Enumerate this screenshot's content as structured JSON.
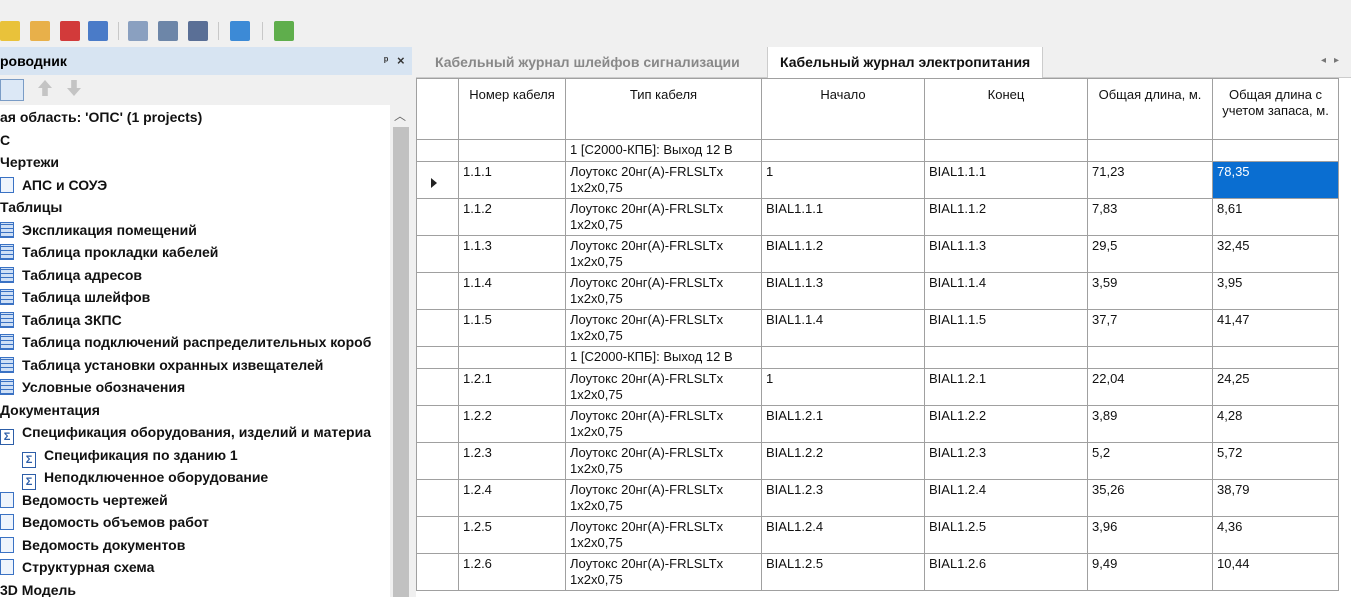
{
  "colors": {
    "accent": "#0a6ed1",
    "header_bg": "#d7e4f2"
  },
  "toolbar": {
    "icons": [
      "new-icon",
      "open-icon",
      "close-file-icon",
      "save-icon",
      "properties-icon",
      "settings-icon",
      "print-icon",
      "tree-icon",
      "add-sheet-icon"
    ]
  },
  "explorer": {
    "title": "роводник",
    "pin_glyph": "ᵖ",
    "close_glyph": "×",
    "tree": [
      {
        "label": "ая область: 'ОПС' (1 projects)",
        "icon": "none",
        "indent": 0
      },
      {
        "label": "С",
        "icon": "none",
        "indent": 0
      },
      {
        "label": "Чертежи",
        "icon": "none",
        "indent": 0
      },
      {
        "label": "АПС и СОУЭ",
        "icon": "drawing-icon",
        "indent": 1
      },
      {
        "label": "Таблицы",
        "icon": "none",
        "indent": 0
      },
      {
        "label": "Экспликация помещений",
        "icon": "table-icon",
        "indent": 1
      },
      {
        "label": "Таблица прокладки кабелей",
        "icon": "table-icon",
        "indent": 1
      },
      {
        "label": "Таблица адресов",
        "icon": "table-icon",
        "indent": 1
      },
      {
        "label": "Таблица шлейфов",
        "icon": "table-icon",
        "indent": 1
      },
      {
        "label": "Таблица ЗКПС",
        "icon": "table-icon",
        "indent": 1
      },
      {
        "label": "Таблица подключений распределительных короб",
        "icon": "table-icon",
        "indent": 1
      },
      {
        "label": "Таблица установки охранных извещателей",
        "icon": "table-icon",
        "indent": 1
      },
      {
        "label": "Условные обозначения",
        "icon": "table-icon",
        "indent": 1
      },
      {
        "label": "Документация",
        "icon": "none",
        "indent": 0
      },
      {
        "label": "Спецификация оборудования, изделий и материа",
        "icon": "sigma-icon",
        "indent": 1
      },
      {
        "label": "Спецификация по зданию 1",
        "icon": "sigma-icon",
        "indent": 2
      },
      {
        "label": "Неподключенное оборудование",
        "icon": "sigma-icon",
        "indent": 2
      },
      {
        "label": "Ведомость чертежей",
        "icon": "document-icon",
        "indent": 1
      },
      {
        "label": "Ведомость объемов работ",
        "icon": "document-icon",
        "indent": 1
      },
      {
        "label": "Ведомость документов",
        "icon": "document-icon",
        "indent": 1
      },
      {
        "label": "Структурная схема",
        "icon": "document-icon",
        "indent": 1
      },
      {
        "label": "3D Модель",
        "icon": "none",
        "indent": 0
      }
    ]
  },
  "tabs": [
    {
      "label": "Кабельный журнал шлейфов сигнализации",
      "active": false
    },
    {
      "label": "Кабельный журнал электропитания",
      "active": true
    }
  ],
  "tab_nav": {
    "left": "◂",
    "right": "▸"
  },
  "grid": {
    "columns": [
      "Номер кабеля",
      "Тип кабеля",
      "Начало",
      "Конец",
      "Общая длина, м.",
      "Общая длина с учетом запаса, м."
    ],
    "rows": [
      {
        "type": "group",
        "label": "1 [С2000-КПБ]: Выход 12 В"
      },
      {
        "type": "data",
        "current": true,
        "cells": [
          "1.1.1",
          "Лоутокс 20нг(А)-FRLSLTx 1x2x0,75",
          "1",
          "BIAL1.1.1",
          "71,23",
          "78,35"
        ]
      },
      {
        "type": "data",
        "cells": [
          "1.1.2",
          "Лоутокс 20нг(А)-FRLSLTx 1x2x0,75",
          "BIAL1.1.1",
          "BIAL1.1.2",
          "7,83",
          "8,61"
        ]
      },
      {
        "type": "data",
        "cells": [
          "1.1.3",
          "Лоутокс 20нг(А)-FRLSLTx 1x2x0,75",
          "BIAL1.1.2",
          "BIAL1.1.3",
          "29,5",
          "32,45"
        ]
      },
      {
        "type": "data",
        "cells": [
          "1.1.4",
          "Лоутокс 20нг(А)-FRLSLTx 1x2x0,75",
          "BIAL1.1.3",
          "BIAL1.1.4",
          "3,59",
          "3,95"
        ]
      },
      {
        "type": "data",
        "cells": [
          "1.1.5",
          "Лоутокс 20нг(А)-FRLSLTx 1x2x0,75",
          "BIAL1.1.4",
          "BIAL1.1.5",
          "37,7",
          "41,47"
        ]
      },
      {
        "type": "group",
        "label": "1 [С2000-КПБ]: Выход 12 В"
      },
      {
        "type": "data",
        "cells": [
          "1.2.1",
          "Лоутокс 20нг(А)-FRLSLTx 1x2x0,75",
          "1",
          "BIAL1.2.1",
          "22,04",
          "24,25"
        ]
      },
      {
        "type": "data",
        "cells": [
          "1.2.2",
          "Лоутокс 20нг(А)-FRLSLTx 1x2x0,75",
          "BIAL1.2.1",
          "BIAL1.2.2",
          "3,89",
          "4,28"
        ]
      },
      {
        "type": "data",
        "cells": [
          "1.2.3",
          "Лоутокс 20нг(А)-FRLSLTx 1x2x0,75",
          "BIAL1.2.2",
          "BIAL1.2.3",
          "5,2",
          "5,72"
        ]
      },
      {
        "type": "data",
        "cells": [
          "1.2.4",
          "Лоутокс 20нг(А)-FRLSLTx 1x2x0,75",
          "BIAL1.2.3",
          "BIAL1.2.4",
          "35,26",
          "38,79"
        ]
      },
      {
        "type": "data",
        "cells": [
          "1.2.5",
          "Лоутокс 20нг(А)-FRLSLTx 1x2x0,75",
          "BIAL1.2.4",
          "BIAL1.2.5",
          "3,96",
          "4,36"
        ]
      },
      {
        "type": "data",
        "cells": [
          "1.2.6",
          "Лоутокс 20нг(А)-FRLSLTx 1x2x0,75",
          "BIAL1.2.5",
          "BIAL1.2.6",
          "9,49",
          "10,44"
        ]
      }
    ]
  }
}
